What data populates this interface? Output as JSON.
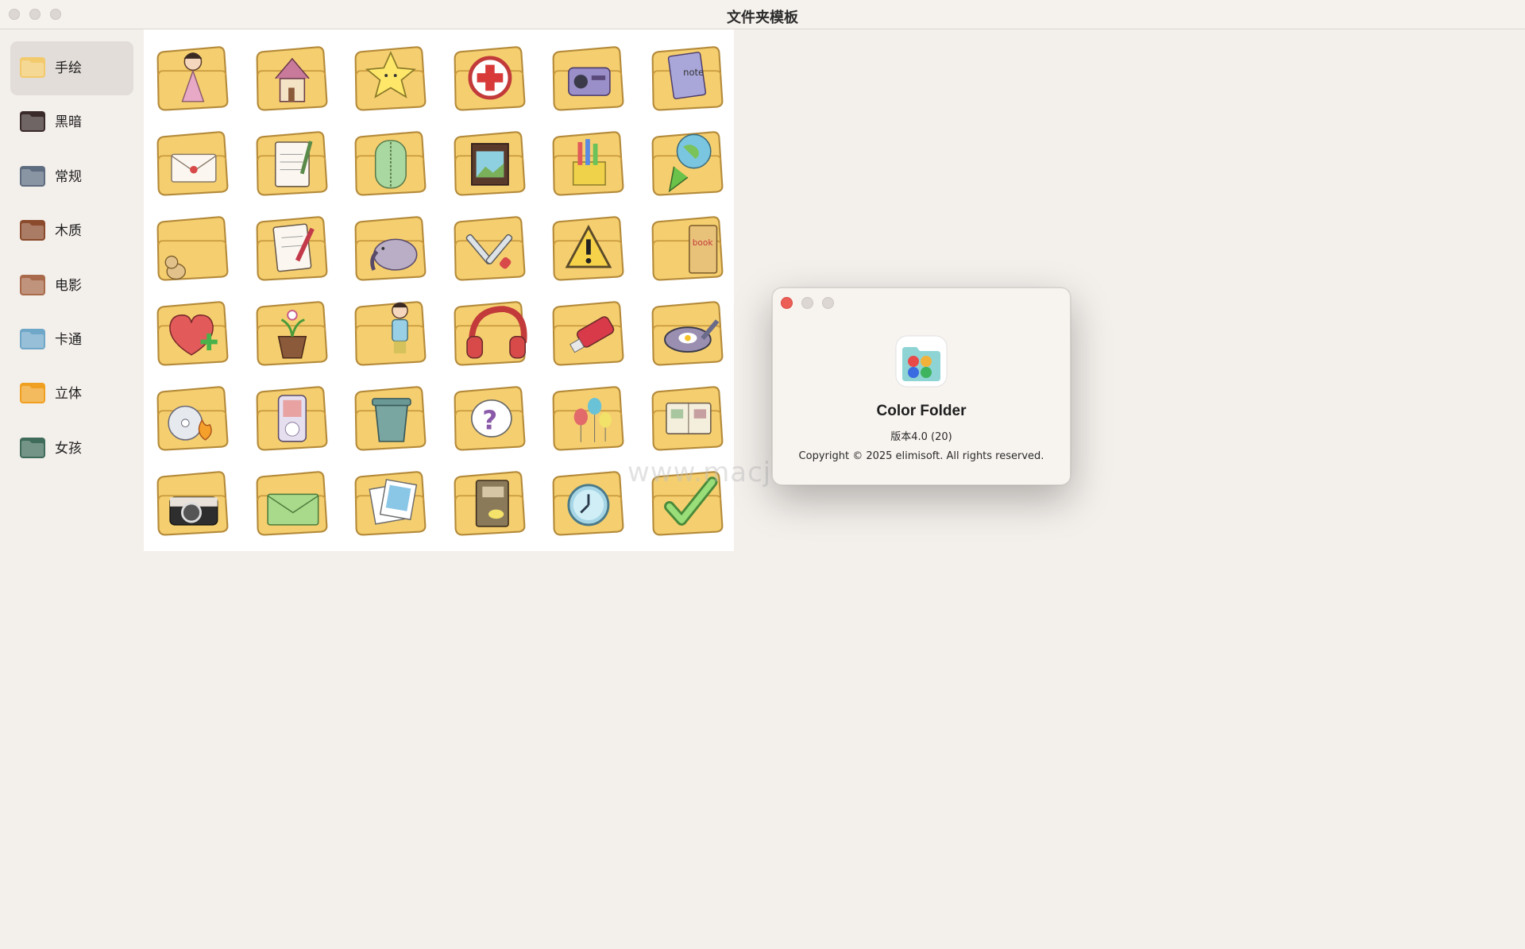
{
  "window": {
    "title": "文件夹模板",
    "buttons": [
      "close",
      "minimize",
      "zoom"
    ]
  },
  "sidebar": {
    "items": [
      {
        "label": "手绘",
        "selected": true,
        "thumb_color": "#f2c96b",
        "icon": "hand-drawn-folder-icon"
      },
      {
        "label": "黑暗",
        "selected": false,
        "thumb_color": "#3a2a2a",
        "icon": "dark-folder-icon"
      },
      {
        "label": "常规",
        "selected": false,
        "thumb_color": "#5e6c80",
        "icon": "regular-folder-icon"
      },
      {
        "label": "木质",
        "selected": false,
        "thumb_color": "#8a4a2b",
        "icon": "wood-folder-icon"
      },
      {
        "label": "电影",
        "selected": false,
        "thumb_color": "#a86a4a",
        "icon": "movie-folder-icon"
      },
      {
        "label": "卡通",
        "selected": false,
        "thumb_color": "#6fa7c8",
        "icon": "cartoon-folder-icon"
      },
      {
        "label": "立体",
        "selected": false,
        "thumb_color": "#f0a020",
        "icon": "3d-folder-icon"
      },
      {
        "label": "女孩",
        "selected": false,
        "thumb_color": "#3f6b5a",
        "icon": "girl-folder-icon"
      }
    ]
  },
  "grid": {
    "columns": 6,
    "folder_color": "#f5cf6f",
    "items": [
      {
        "name": "girl-folder-icon",
        "symbol": "girl",
        "text": ""
      },
      {
        "name": "house-folder-icon",
        "symbol": "house",
        "text": ""
      },
      {
        "name": "star-folder-icon",
        "symbol": "star",
        "text": ""
      },
      {
        "name": "medical-cross-folder-icon",
        "symbol": "cross",
        "text": ""
      },
      {
        "name": "radio-folder-icon",
        "symbol": "radio",
        "text": ""
      },
      {
        "name": "notes-folder-icon",
        "symbol": "notes",
        "text": "note"
      },
      {
        "name": "mail-folder-icon",
        "symbol": "mail",
        "text": ""
      },
      {
        "name": "clipboard-pencil-folder-icon",
        "symbol": "clipboard",
        "text": ""
      },
      {
        "name": "zipper-folder-icon",
        "symbol": "zip",
        "text": ""
      },
      {
        "name": "film-folder-icon",
        "symbol": "film",
        "text": ""
      },
      {
        "name": "pencil-box-folder-icon",
        "symbol": "pencils",
        "text": ""
      },
      {
        "name": "globe-download-folder-icon",
        "symbol": "globe",
        "text": ""
      },
      {
        "name": "dog-folder-icon",
        "symbol": "dog",
        "text": ""
      },
      {
        "name": "checklist-folder-icon",
        "symbol": "checklist",
        "text": ""
      },
      {
        "name": "elephant-folder-icon",
        "symbol": "elephant",
        "text": ""
      },
      {
        "name": "tools-folder-icon",
        "symbol": "tools",
        "text": ""
      },
      {
        "name": "warning-folder-icon",
        "symbol": "warning",
        "text": ""
      },
      {
        "name": "book-folder-icon",
        "symbol": "book",
        "text": "book"
      },
      {
        "name": "heart-plus-folder-icon",
        "symbol": "heart",
        "text": ""
      },
      {
        "name": "plant-pot-folder-icon",
        "symbol": "plant",
        "text": ""
      },
      {
        "name": "boy-folder-icon",
        "symbol": "boy",
        "text": ""
      },
      {
        "name": "headphones-folder-icon",
        "symbol": "headphones",
        "text": ""
      },
      {
        "name": "usb-drive-folder-icon",
        "symbol": "usb",
        "text": ""
      },
      {
        "name": "frying-pan-folder-icon",
        "symbol": "pan",
        "text": ""
      },
      {
        "name": "burning-cd-folder-icon",
        "symbol": "cd",
        "text": ""
      },
      {
        "name": "music-player-folder-icon",
        "symbol": "player",
        "text": ""
      },
      {
        "name": "trash-can-folder-icon",
        "symbol": "trash",
        "text": ""
      },
      {
        "name": "question-folder-icon",
        "symbol": "question",
        "text": ""
      },
      {
        "name": "balloons-folder-icon",
        "symbol": "balloons",
        "text": ""
      },
      {
        "name": "photo-album-folder-icon",
        "symbol": "album",
        "text": ""
      },
      {
        "name": "camera-folder-icon",
        "symbol": "camera",
        "text": ""
      },
      {
        "name": "envelope-folder-icon",
        "symbol": "envelope",
        "text": ""
      },
      {
        "name": "photos-folder-icon",
        "symbol": "photos",
        "text": ""
      },
      {
        "name": "notebook-folder-icon",
        "symbol": "notebook",
        "text": ""
      },
      {
        "name": "clock-folder-icon",
        "symbol": "clock",
        "text": ""
      },
      {
        "name": "checkmark-folder-icon",
        "symbol": "check",
        "text": ""
      }
    ]
  },
  "about": {
    "app_name": "Color Folder",
    "version": "版本4.0 (20)",
    "copyright": "Copyright © 2025  elimisoft. All rights reserved.",
    "icon": "color-folder-app-icon",
    "close_color": "#ec5f57"
  },
  "watermark": "www.macjb.com"
}
